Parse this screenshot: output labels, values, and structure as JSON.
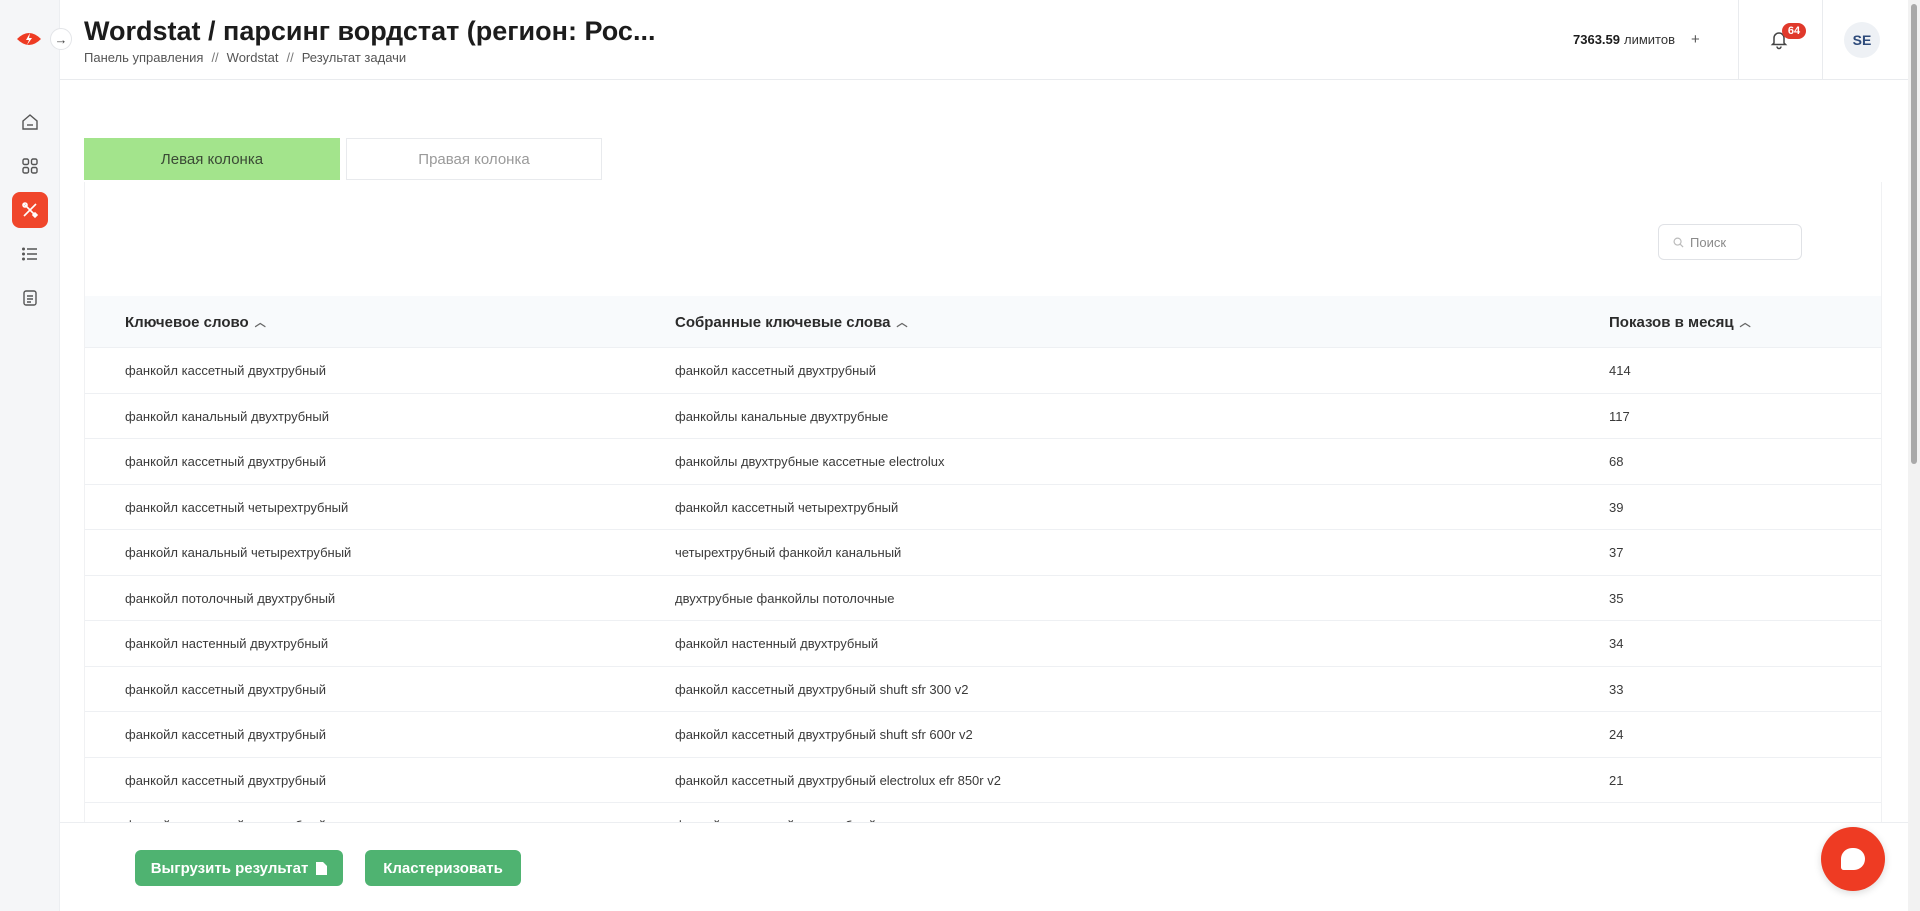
{
  "header": {
    "title": "Wordstat / парсинг вордстат (регион: Рос...",
    "breadcrumb": [
      "Панель управления",
      "Wordstat",
      "Результат задачи"
    ],
    "breadcrumb_sep": "//",
    "limits_value": "7363.59",
    "limits_label": "лимитов",
    "limits_add": "+",
    "notifications_count": "64",
    "avatar_initials": "SE"
  },
  "sidebar": {
    "items": [
      {
        "icon": "home-icon"
      },
      {
        "icon": "grid-icon"
      },
      {
        "icon": "tools-icon",
        "active": true
      },
      {
        "icon": "list-icon"
      },
      {
        "icon": "document-icon"
      }
    ],
    "toggle": "→",
    "accent": "#f0462b"
  },
  "tabs": {
    "left": "Левая колонка",
    "right": "Правая колонка",
    "active_color": "#a3e48c"
  },
  "search": {
    "placeholder": "Поиск",
    "value": ""
  },
  "table": {
    "columns": [
      "Ключевое слово",
      "Собранные ключевые слова",
      "Показов в месяц"
    ],
    "rows": [
      [
        "фанкойл кассетный двухтрубный",
        "фанкойл кассетный двухтрубный",
        "414"
      ],
      [
        "фанкойл канальный двухтрубный",
        "фанкойлы канальные двухтрубные",
        "117"
      ],
      [
        "фанкойл кассетный двухтрубный",
        "фанкойлы двухтрубные кассетные electrolux",
        "68"
      ],
      [
        "фанкойл кассетный четырехтрубный",
        "фанкойл кассетный четырехтрубный",
        "39"
      ],
      [
        "фанкойл канальный четырехтрубный",
        "четырехтрубный фанкойл канальный",
        "37"
      ],
      [
        "фанкойл потолочный двухтрубный",
        "двухтрубные фанкойлы потолочные",
        "35"
      ],
      [
        "фанкойл настенный двухтрубный",
        "фанкойл настенный двухтрубный",
        "34"
      ],
      [
        "фанкойл кассетный двухтрубный",
        "фанкойл кассетный двухтрубный shuft sfr 300 v2",
        "33"
      ],
      [
        "фанкойл кассетный двухтрубный",
        "фанкойл кассетный двухтрубный shuft sfr 600r v2",
        "24"
      ],
      [
        "фанкойл кассетный двухтрубный",
        "фанкойл кассетный двухтрубный electrolux efr 850r v2",
        "21"
      ],
      [
        "фанкойл кассетный двухтрубный",
        "фанкойл кассетный двухтрубный",
        ""
      ]
    ]
  },
  "footer": {
    "export_label": "Выгрузить результат",
    "cluster_label": "Кластеризовать",
    "button_color": "#4fb371"
  }
}
